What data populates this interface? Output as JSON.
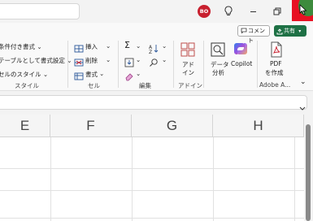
{
  "titlebar": {
    "avatar_initials": "BO",
    "icons": [
      "lightbulb-icon",
      "minimize-icon",
      "restore-icon",
      "close-icon"
    ]
  },
  "ribbon": {
    "comment_label": "コメント",
    "share_label": "共有",
    "styles": {
      "conditional_label": "条件付き書式",
      "table_label": "テーブルとして書式設定",
      "cellstyle_label": "セルのスタイル",
      "group_label": "スタイル"
    },
    "cells": {
      "insert_label": "挿入",
      "delete_label": "削除",
      "format_label": "書式",
      "group_label": "セル"
    },
    "edit": {
      "group_label": "編集"
    },
    "addins": {
      "addin_line1": "アド",
      "addin_line2": "イン",
      "group_label": "アドイン"
    },
    "analysis": {
      "data_line1": "データ",
      "data_line2": "分析",
      "copilot_label": "Copilot"
    },
    "adobe": {
      "pdf_line1": "PDF",
      "pdf_line2": "を作成",
      "group_label": "Adobe A..."
    }
  },
  "grid": {
    "columns": [
      "E",
      "F",
      "G",
      "H"
    ]
  },
  "colors": {
    "share_green": "#1e7145",
    "close_red": "#e81123",
    "avatar_red": "#c8202f"
  }
}
